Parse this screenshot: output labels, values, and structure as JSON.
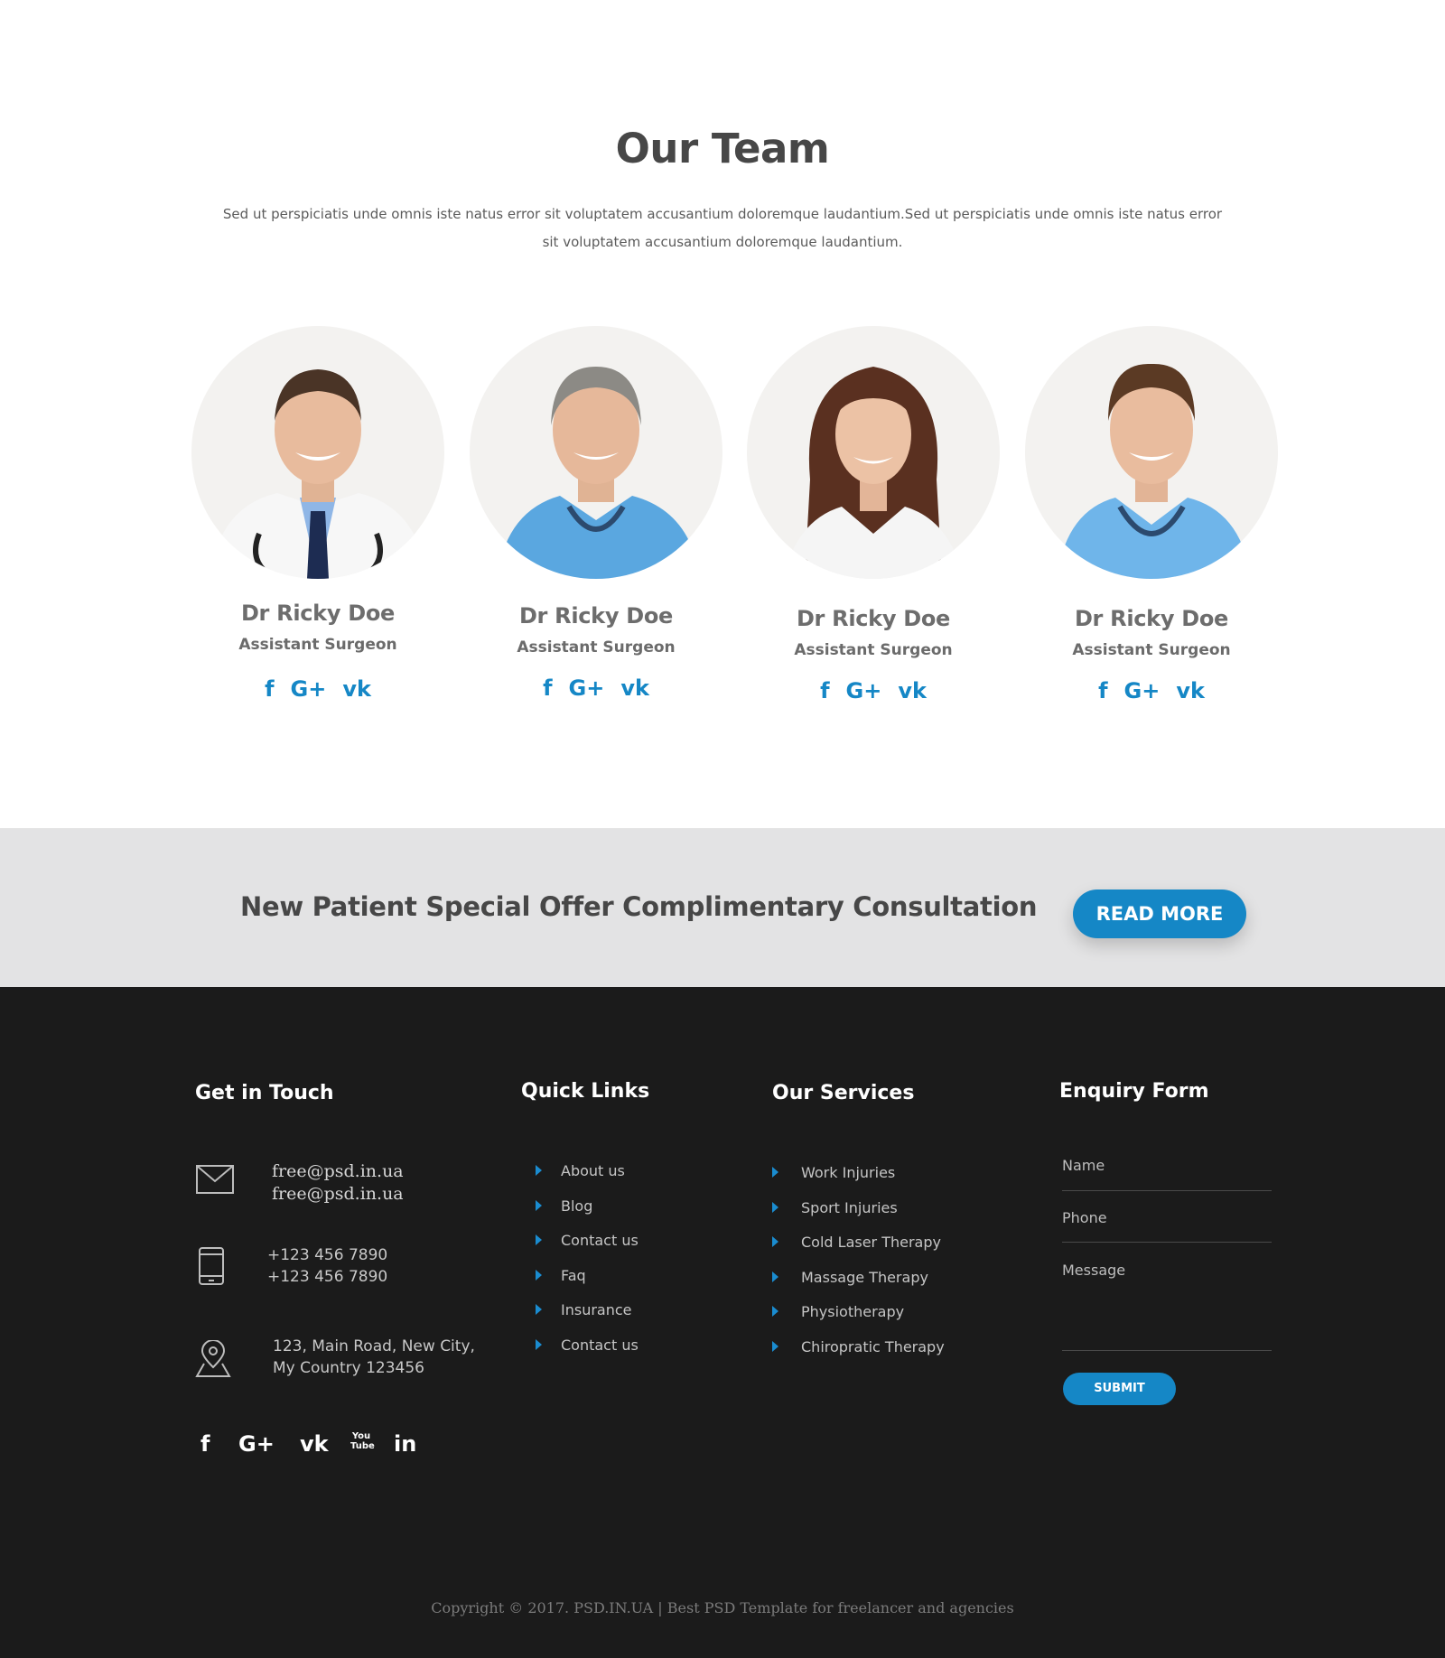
{
  "team": {
    "title": "Our Team",
    "description": "Sed ut perspiciatis unde omnis iste natus error sit voluptatem accusantium doloremque laudantium.Sed ut perspiciatis unde omnis iste natus error sit voluptatem accusantium doloremque laudantium.",
    "members": [
      {
        "name": "Dr Ricky Doe",
        "role": "Assistant Surgeon"
      },
      {
        "name": "Dr Ricky Doe",
        "role": "Assistant Surgeon"
      },
      {
        "name": "Dr Ricky Doe",
        "role": "Assistant Surgeon"
      },
      {
        "name": "Dr Ricky Doe",
        "role": "Assistant Surgeon"
      }
    ],
    "social_icons": {
      "facebook": "f",
      "google_plus": "G+",
      "vk": "vk"
    }
  },
  "offer": {
    "text": "New Patient Special Offer Complimentary Consultation",
    "button_label": "READ MORE"
  },
  "footer": {
    "get_in_touch": {
      "heading": "Get in Touch",
      "emails": [
        "free@psd.in.ua",
        "free@psd.in.ua"
      ],
      "phones": [
        "+123 456 7890",
        "+123 456 7890"
      ],
      "address": [
        "123, Main Road, New City,",
        "My Country 123456"
      ]
    },
    "quick_links": {
      "heading": "Quick Links",
      "items": [
        "About us",
        "Blog",
        "Contact us",
        "Faq",
        "Insurance",
        "Contact us"
      ]
    },
    "services": {
      "heading": "Our Services",
      "items": [
        "Work Injuries",
        "Sport Injuries",
        "Cold Laser Therapy",
        "Massage Therapy",
        "Physiotherapy",
        "Chiropratic Therapy"
      ]
    },
    "enquiry": {
      "heading": "Enquiry Form",
      "name_placeholder": "Name",
      "phone_placeholder": "Phone",
      "message_placeholder": "Message",
      "submit_label": "SUBMIT"
    },
    "social": {
      "facebook": "f",
      "google_plus": "G+",
      "vk": "vk",
      "youtube": "You Tube",
      "linkedin": "in"
    },
    "copyright": "Copyright © 2017. PSD.IN.UA  | Best PSD Template for freelancer and agencies"
  },
  "colors": {
    "accent": "#1587c6",
    "footer_bg": "#1b1b1b",
    "band_bg": "#e3e3e4",
    "heading": "#474747"
  }
}
